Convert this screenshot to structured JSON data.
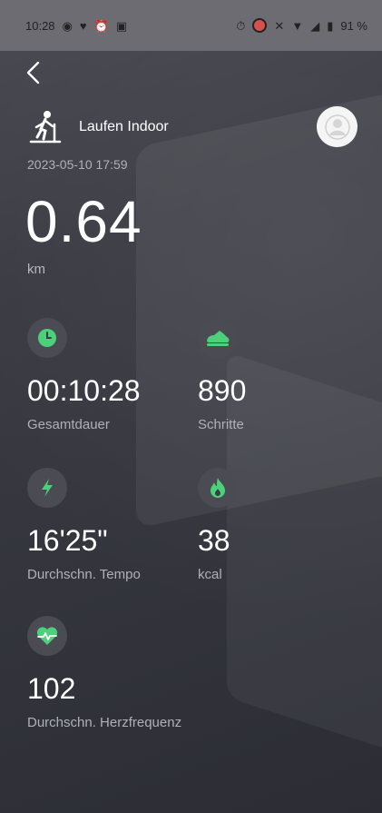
{
  "status_bar": {
    "time": "10:28",
    "battery": "91 %"
  },
  "header": {
    "activity": "Laufen Indoor",
    "datetime": "2023-05-10 17:59"
  },
  "summary": {
    "distance": "0.64",
    "distance_unit": "km"
  },
  "metrics": [
    {
      "icon": "clock-icon",
      "value": "00:10:28",
      "label": "Gesamtdauer"
    },
    {
      "icon": "shoe-icon",
      "value": "890",
      "label": "Schritte"
    },
    {
      "icon": "lightning-icon",
      "value": "16'25\"",
      "label": "Durchschn. Tempo"
    },
    {
      "icon": "flame-icon",
      "value": "38",
      "label": "kcal"
    },
    {
      "icon": "heartbeat-icon",
      "value": "102",
      "label": "Durchschn. Herzfrequenz"
    }
  ],
  "colors": {
    "accent": "#4cd07a",
    "muted_text": "#b0b0b6"
  }
}
